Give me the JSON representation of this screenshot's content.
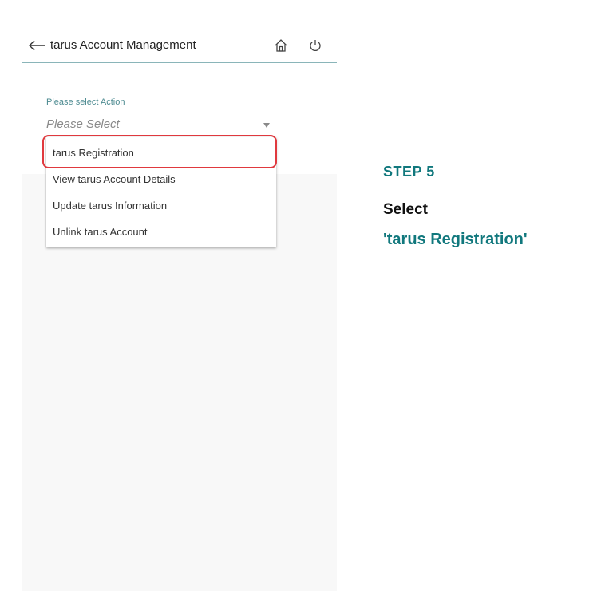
{
  "app": {
    "title": "tarus Account Management",
    "icons": {
      "back": "arrow-left-icon",
      "home": "home-icon",
      "power": "power-icon"
    },
    "accent_color": "#11787d",
    "highlight_color": "#e0393e"
  },
  "form": {
    "label": "Please select Action",
    "placeholder": "Please Select",
    "options": [
      "tarus Registration",
      "View tarus Account Details",
      "Update tarus Information",
      "Unlink tarus Account"
    ],
    "highlighted_option": "tarus Registration"
  },
  "instruction": {
    "step": "STEP 5",
    "text": "Select",
    "target": "'tarus Registration'"
  }
}
